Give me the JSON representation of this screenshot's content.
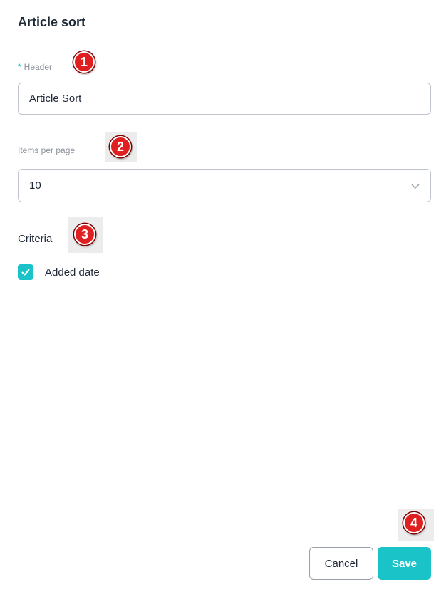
{
  "dialog": {
    "title": "Article sort"
  },
  "header_field": {
    "required_mark": "*",
    "label": "Header",
    "value": "Article Sort"
  },
  "items_per_page_field": {
    "label": "Items per page",
    "selected": "10"
  },
  "criteria": {
    "label": "Criteria",
    "options": [
      {
        "label": "Added date",
        "checked": true
      }
    ]
  },
  "buttons": {
    "cancel": "Cancel",
    "save": "Save"
  },
  "markers": [
    "1",
    "2",
    "3",
    "4"
  ],
  "colors": {
    "accent": "#19c3c8",
    "marker": "#e02020"
  }
}
